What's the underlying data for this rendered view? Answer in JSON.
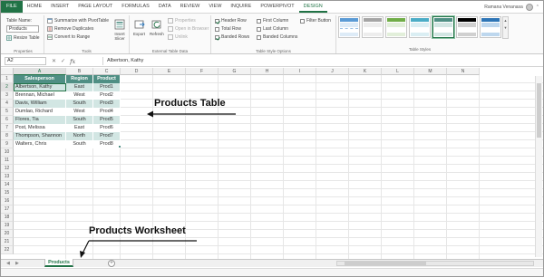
{
  "ribbon_tabs": [
    "FILE",
    "HOME",
    "INSERT",
    "PAGE LAYOUT",
    "FORMULAS",
    "DATA",
    "REVIEW",
    "VIEW",
    "INQUIRE",
    "POWERPIVOT",
    "DESIGN"
  ],
  "user_name": "Ramana Venanasa",
  "properties": {
    "table_name_label": "Table Name:",
    "table_name_value": "Products",
    "resize_table": "Resize Table",
    "group_label": "Properties"
  },
  "tools": {
    "summarize": "Summarize with PivotTable",
    "remove_duplicates": "Remove Duplicates",
    "convert_to_range": "Convert to Range",
    "insert_slicer": "Insert Slicer",
    "group_label": "Tools"
  },
  "external": {
    "export": "Export",
    "refresh": "Refresh",
    "properties": "Properties",
    "open_in_browser": "Open in Browser",
    "unlink": "Unlink",
    "group_label": "External Table Data"
  },
  "style_options": {
    "header_row": "Header Row",
    "total_row": "Total Row",
    "banded_rows": "Banded Rows",
    "first_column": "First Column",
    "last_column": "Last Column",
    "banded_columns": "Banded Columns",
    "filter_button": "Filter Button",
    "group_label": "Table Style Options"
  },
  "table_styles_label": "Table Styles",
  "colors": {
    "accent": "#217346",
    "header_fill": "#4f8f84",
    "band_fill": "#d2e6e3"
  },
  "formula_bar": {
    "name_box": "A2",
    "content": "Albertson, Kathy",
    "fx": "fx",
    "cancel": "✕",
    "enter": "✓"
  },
  "columns": [
    "A",
    "B",
    "C",
    "D",
    "E",
    "F",
    "G",
    "H",
    "I",
    "J",
    "K",
    "L",
    "M",
    "N"
  ],
  "rows": [
    "1",
    "2",
    "3",
    "4",
    "5",
    "6",
    "7",
    "8",
    "9",
    "10",
    "11",
    "12",
    "13",
    "14",
    "15",
    "16",
    "17",
    "18",
    "19",
    "20",
    "21",
    "22"
  ],
  "table": {
    "headers": [
      "Salesperson",
      "Region",
      "Product"
    ],
    "rows": [
      [
        "Albertson, Kathy",
        "East",
        "Prod1"
      ],
      [
        "Brennan, Michael",
        "West",
        "Prod2"
      ],
      [
        "Davis, William",
        "South",
        "Prod3"
      ],
      [
        "Dumlao, Richard",
        "West",
        "Prod4"
      ],
      [
        "Flores, Tia",
        "South",
        "Prod5"
      ],
      [
        "Post, Melissa",
        "East",
        "Prod6"
      ],
      [
        "Thompson, Shannon",
        "North",
        "Prod7"
      ],
      [
        "Walters, Chris",
        "South",
        "Prod8"
      ]
    ]
  },
  "annotations": {
    "table_label": "Products Table",
    "sheet_label": "Products Worksheet"
  },
  "sheet_tabs": [
    "Products"
  ]
}
